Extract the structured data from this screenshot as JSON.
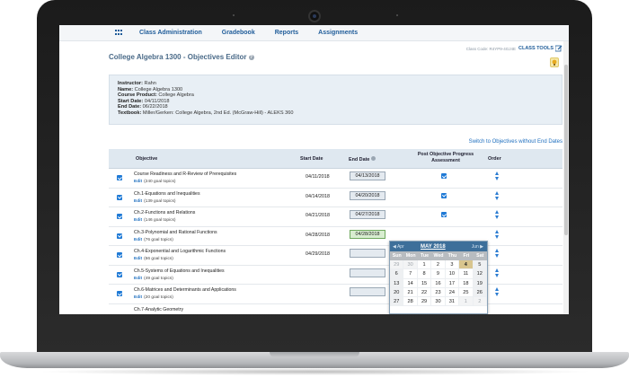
{
  "nav": {
    "items": [
      "Class Administration",
      "Gradebook",
      "Reports",
      "Assignments"
    ]
  },
  "header": {
    "class_code": "Class Code: R4YP9-4GJ4E",
    "class_tools": "CLASS TOOLS",
    "page_title": "College Algebra 1300 - Objectives Editor"
  },
  "info": {
    "instructor_label": "Instructor:",
    "instructor": "Rahn",
    "name_label": "Name:",
    "name": "College Algebra 1300",
    "product_label": "Course Product:",
    "product": "College Algebra",
    "start_label": "Start Date:",
    "start": "04/11/2018",
    "end_label": "End Date:",
    "end": "06/22/2018",
    "textbook_label": "Textbook:",
    "textbook": "Miller/Gerken: College Algebra, 2nd Ed. (McGraw-Hill) - ALEKS 360"
  },
  "switch_link": "Switch to Objectives without End Dates",
  "table": {
    "headers": {
      "objective": "Objective",
      "start_date": "Start Date",
      "end_date": "End Date",
      "post_assessment": "Post Objective Progress Assessment",
      "order": "Order"
    },
    "edit_label": "Edit",
    "rows": [
      {
        "name": "Course Readiness and R-Review of Prerequisites",
        "topics": "(240 goal topics)",
        "start": "04/11/2018",
        "end": "04/13/2018"
      },
      {
        "name": "Ch.1-Equations and Inequalities",
        "topics": "(139 goal topics)",
        "start": "04/14/2018",
        "end": "04/20/2018"
      },
      {
        "name": "Ch.2-Functions and Relations",
        "topics": "(146 goal topics)",
        "start": "04/21/2018",
        "end": "04/27/2018"
      },
      {
        "name": "Ch.3-Polynomial and Rational Functions",
        "topics": "(76 goal topics)",
        "start": "04/28/2018",
        "end": "04/28/2018"
      },
      {
        "name": "Ch.4-Exponential and Logarithmic Functions",
        "topics": "(66 goal topics)",
        "start": "04/29/2018",
        "end": ""
      },
      {
        "name": "Ch.5-Systems of Equations and Inequalities",
        "topics": "(49 goal topics)",
        "start": "",
        "end": ""
      },
      {
        "name": "Ch.6-Matrices and Determinants and Applications",
        "topics": "(20 goal topics)",
        "start": "",
        "end": ""
      },
      {
        "name": "Ch.7-Analytic Geometry",
        "topics": "",
        "start": "",
        "end": ""
      }
    ]
  },
  "calendar": {
    "prev": "◀ Apr",
    "title": "MAY 2018",
    "next": "Jun ▶",
    "days_of_week": [
      "Sun",
      "Mon",
      "Tue",
      "Wed",
      "Thu",
      "Fri",
      "Sat"
    ],
    "weeks": [
      [
        "29",
        "30",
        "1",
        "2",
        "3",
        "4",
        "5"
      ],
      [
        "6",
        "7",
        "8",
        "9",
        "10",
        "11",
        "12"
      ],
      [
        "13",
        "14",
        "15",
        "16",
        "17",
        "18",
        "19"
      ],
      [
        "20",
        "21",
        "22",
        "23",
        "24",
        "25",
        "26"
      ],
      [
        "27",
        "28",
        "29",
        "30",
        "31",
        "1",
        "2"
      ]
    ],
    "today": "4"
  },
  "colors": {
    "nav_link": "#1f5c99",
    "checkbox": "#1f7ad6",
    "calendar_header": "#3d6f9a",
    "active_date": "#d8edd0"
  }
}
